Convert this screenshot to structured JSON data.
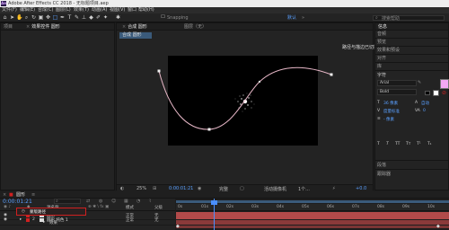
{
  "titlebar": {
    "logo": "Ae",
    "title": "Adobe After Effects CC 2018 - 无标题项目.aep"
  },
  "menubar": {
    "items": [
      "文件(F)",
      "编辑(E)",
      "合成(C)",
      "图层(L)",
      "效果(T)",
      "动画(A)",
      "视图(V)",
      "窗口",
      "帮助(H)"
    ]
  },
  "toolbar": {
    "snapping_label": "Snapping",
    "workspace_default": "默认",
    "workspace_menu": "»",
    "search_placeholder": "搜索帮助"
  },
  "project_panel": {
    "tab_project": "项目",
    "tab_effect_controls": "效果控件 圆形"
  },
  "composition_panel": {
    "tab_label": "合成 圆形",
    "header_label": "图层（无）",
    "hint_text": "路径与描边已切换",
    "zoom": "25%",
    "timecode": "0:00:01:21",
    "resolution": "完整",
    "camera": "活动摄像机",
    "views": "1个...",
    "exposure": "+0.0"
  },
  "right_panel": {
    "info_label": "信息",
    "audio_label": "音频",
    "preview_label": "预览",
    "effects_label": "效果和预设",
    "align_label": "对齐",
    "libraries_label": "库",
    "character_label": "字符",
    "paragraph_label": "段落",
    "tracker_label": "跟踪器",
    "font_name": "Arial",
    "font_style": "Bold",
    "font_size": "36 像素",
    "leading": "自动",
    "tracking": "0",
    "kerning": "度量标准",
    "stroke_width": "- 像素",
    "fill_color": "#f4a8f4",
    "stroke_color": "#ffffff"
  },
  "timeline": {
    "tab_label": "圆形",
    "timecode": "0:00:01:21",
    "column_source": "源名称",
    "column_mode": "模式",
    "column_parent": "父级",
    "ruler_labels": [
      "0s",
      "01s",
      "02s",
      "03s",
      "04s",
      "05s",
      "06s",
      "07s",
      "08s",
      "09s",
      "10s"
    ],
    "layers": [
      {
        "index": "1",
        "name": "圆形",
        "mode": "正常",
        "parent": "无"
      },
      {
        "index": "",
        "name": "效果",
        "mode": "",
        "parent": ""
      },
      {
        "index": "",
        "name": "蒙版路径",
        "mode": "",
        "parent": ""
      },
      {
        "index": "2",
        "name": "圆形 纯色 1",
        "mode": "正常",
        "parent": "无"
      }
    ]
  },
  "colors": {
    "accent": "#5aa0ff",
    "layer_bar": "#b14a4a",
    "path_line": "#e8b8c8",
    "highlight_box": "#d02020"
  }
}
